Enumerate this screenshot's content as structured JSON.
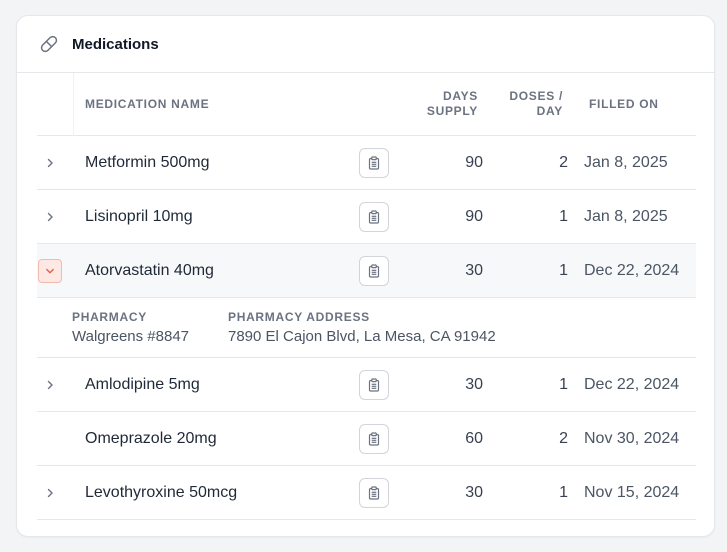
{
  "card": {
    "title": "Medications",
    "icon": "pill-icon"
  },
  "table": {
    "headers": {
      "name": "MEDICATION NAME",
      "days_line1": "DAYS",
      "days_line2": "SUPPLY",
      "doses_line1": "DOSES /",
      "doses_line2": "DAY",
      "filled": "FILLED ON"
    },
    "rows": [
      {
        "name": "Metformin 500mg",
        "days": "90",
        "doses": "2",
        "filled": "Jan 8, 2025",
        "has_chevron": true,
        "expanded": false
      },
      {
        "name": "Lisinopril 10mg",
        "days": "90",
        "doses": "1",
        "filled": "Jan 8, 2025",
        "has_chevron": true,
        "expanded": false
      },
      {
        "name": "Atorvastatin 40mg",
        "days": "30",
        "doses": "1",
        "filled": "Dec 22, 2024",
        "has_chevron": true,
        "expanded": true
      },
      {
        "name": "Amlodipine 5mg",
        "days": "30",
        "doses": "1",
        "filled": "Dec 22, 2024",
        "has_chevron": true,
        "expanded": false
      },
      {
        "name": "Omeprazole 20mg",
        "days": "60",
        "doses": "2",
        "filled": "Nov 30, 2024",
        "has_chevron": false,
        "expanded": false
      },
      {
        "name": "Levothyroxine 50mcg",
        "days": "30",
        "doses": "1",
        "filled": "Nov 15, 2024",
        "has_chevron": true,
        "expanded": false
      }
    ],
    "detail": {
      "pharmacy_label": "PHARMACY",
      "pharmacy_value": "Walgreens #8847",
      "address_label": "PHARMACY ADDRESS",
      "address_value": "7890 El Cajon Blvd, La Mesa, CA 91942"
    }
  },
  "colors": {
    "accent_open_chevron": "#e0634a",
    "border": "#e5e7eb",
    "muted_text": "#6b7280"
  }
}
